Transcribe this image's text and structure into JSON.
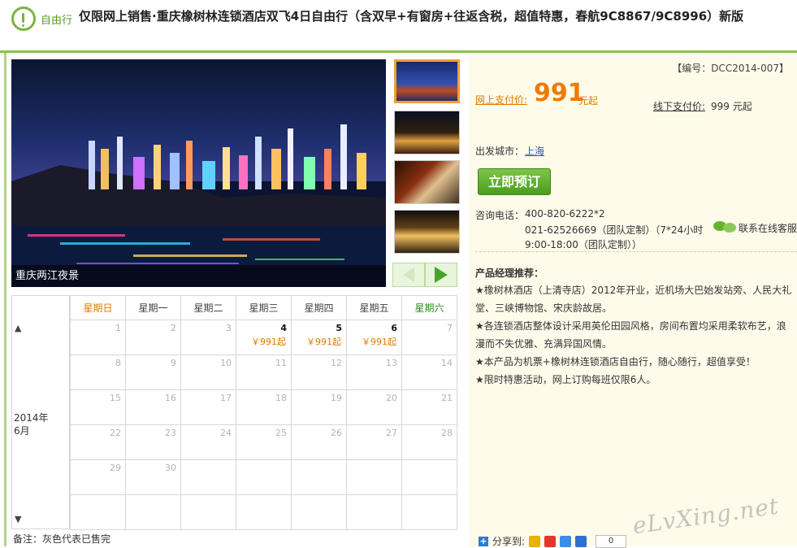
{
  "header": {
    "badge_label": "自由行",
    "title": "仅限网上销售·重庆橡树林连锁酒店双飞4日自由行（含双早+有窗房+往返含税，超值特惠，春航9C8867/9C8996）新版"
  },
  "gallery": {
    "caption": "重庆两江夜景"
  },
  "calendar": {
    "year_month_line1": "2014年",
    "year_month_line2": "6月",
    "up_arrow": "▲",
    "down_arrow": "▼",
    "weekdays": [
      "星期日",
      "星期一",
      "星期二",
      "星期三",
      "星期四",
      "星期五",
      "星期六"
    ],
    "weeks": [
      [
        {
          "d": "1"
        },
        {
          "d": "2"
        },
        {
          "d": "3"
        },
        {
          "d": "4",
          "p": "￥991起"
        },
        {
          "d": "5",
          "p": "￥991起"
        },
        {
          "d": "6",
          "p": "￥991起"
        },
        {
          "d": "7"
        }
      ],
      [
        {
          "d": "8"
        },
        {
          "d": "9"
        },
        {
          "d": "10"
        },
        {
          "d": "11"
        },
        {
          "d": "12"
        },
        {
          "d": "13"
        },
        {
          "d": "14"
        }
      ],
      [
        {
          "d": "15"
        },
        {
          "d": "16"
        },
        {
          "d": "17"
        },
        {
          "d": "18"
        },
        {
          "d": "19"
        },
        {
          "d": "20"
        },
        {
          "d": "21"
        }
      ],
      [
        {
          "d": "22"
        },
        {
          "d": "23"
        },
        {
          "d": "24"
        },
        {
          "d": "25"
        },
        {
          "d": "26"
        },
        {
          "d": "27"
        },
        {
          "d": "28"
        }
      ],
      [
        {
          "d": "29"
        },
        {
          "d": "30"
        },
        {
          "d": ""
        },
        {
          "d": ""
        },
        {
          "d": ""
        },
        {
          "d": ""
        },
        {
          "d": ""
        }
      ],
      [
        {
          "d": ""
        },
        {
          "d": ""
        },
        {
          "d": ""
        },
        {
          "d": ""
        },
        {
          "d": ""
        },
        {
          "d": ""
        },
        {
          "d": ""
        }
      ]
    ],
    "note": "备注：灰色代表已售完"
  },
  "info": {
    "code": "【编号：DCC2014-007】",
    "online_label": "网上支付价:",
    "online_price": "991",
    "online_suffix": "元起",
    "offline_label": "线下支付价:",
    "offline_value": "999 元起",
    "city_label": "出发城市：",
    "city": "上海",
    "book_button": "立即预订",
    "phone_label": "咨询电话：",
    "phone_1": "400-820-6222*2",
    "phone_2": "021-62526669（团队定制）（7*24小时",
    "phone_3": "9:00-18:00（团队定制））",
    "cs_label": "联系在线客服",
    "rec_title": "产品经理推荐：",
    "rec_items": [
      "★橡树林酒店（上清寺店）2012年开业，近机场大巴始发站旁、人民大礼堂、三峡博物馆、宋庆龄故居。",
      "★各连锁酒店整体设计采用英伦田园风格，房间布置均采用柔软布艺，浪漫而不失优雅、充满异国风情。",
      "★本产品为机票+橡树林连锁酒店自由行，随心随行，超值享受！",
      "★限时特惠活动，网上订购每班仅限6人。"
    ],
    "share_label": "分享到:",
    "share_count": "0"
  },
  "watermark": "eLvXing.net",
  "colors": {
    "accent_green": "#7cb342",
    "price_orange": "#f07a00",
    "panel_cream": "#fffbeb"
  }
}
